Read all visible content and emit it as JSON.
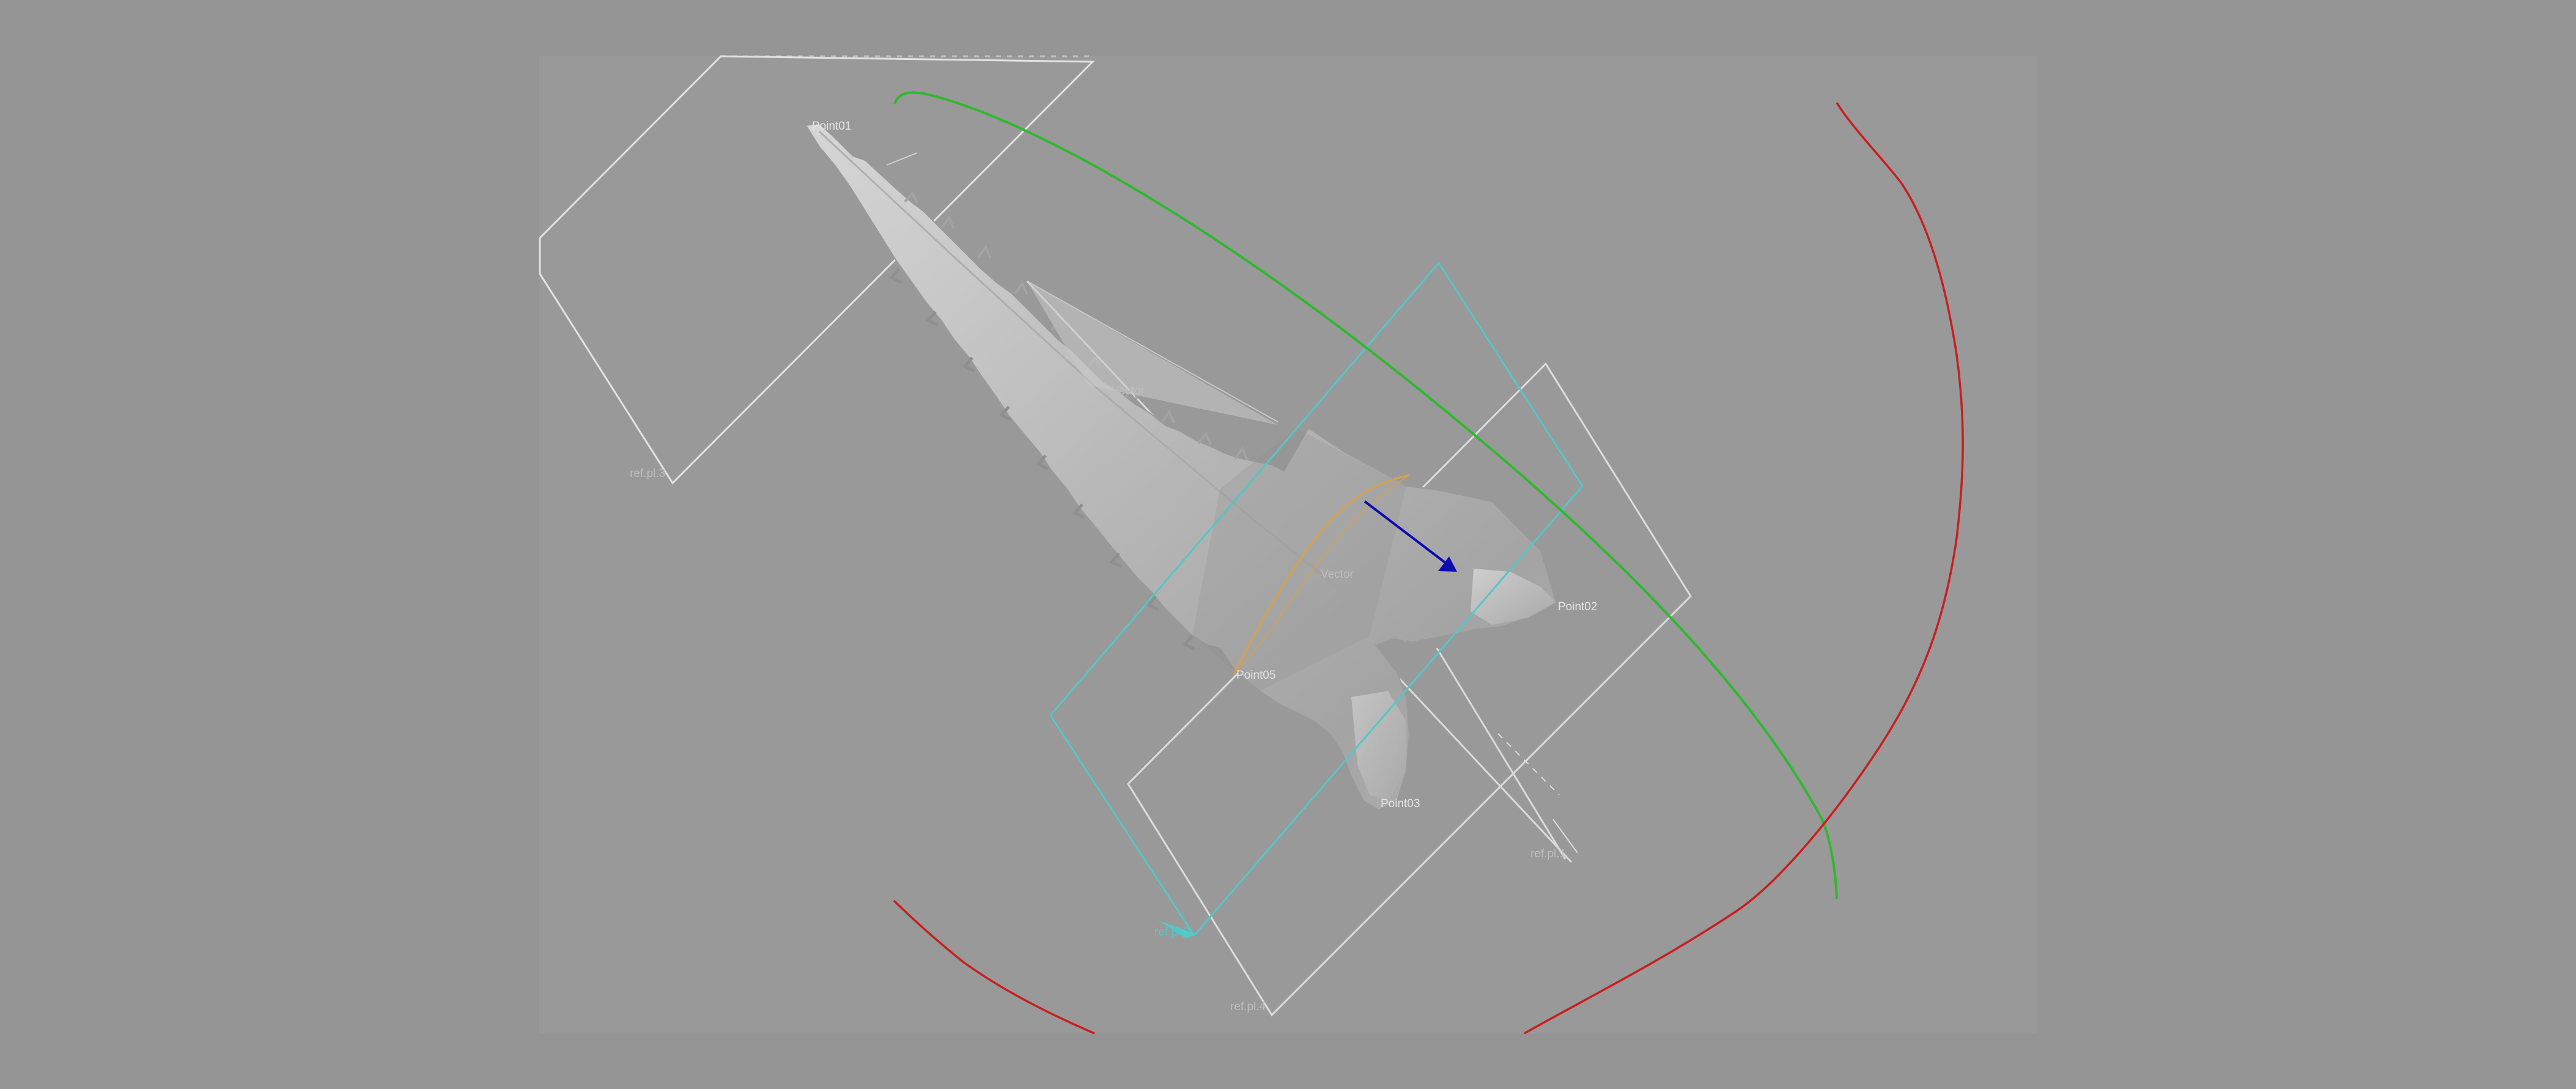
{
  "window": {
    "background_color": "#959595",
    "viewport_color": "#999999"
  },
  "viewport": {
    "labels": {
      "point_top": "Point01",
      "point_right": "Point02",
      "point_bottom": "Point03",
      "point_mid": "Point05",
      "vector_upper": "Vector",
      "vector_center": "Vector",
      "ref_plane_left": "ref.pl.3",
      "ref_plane_bottom": "ref.pl.4",
      "ref_plane_right": "ref.pl.1",
      "ref_plane_cyan": "ref.pl.2"
    },
    "colors": {
      "arc_green": "#2fb82f",
      "arc_red": "#c81e1e",
      "plane_cyan": "#56c6c6",
      "plane_white": "#d8d8d8",
      "vector_blue": "#0b0bb0",
      "section_orange": "#d7a14a",
      "object_surface": "#bdbdbd"
    }
  }
}
